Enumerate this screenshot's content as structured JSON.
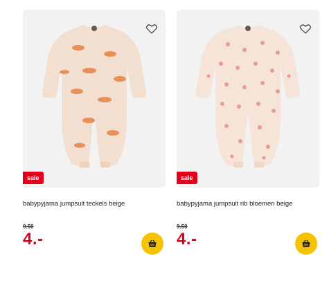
{
  "colors": {
    "sale_red": "#e0001b",
    "basket_yellow": "#f7c300",
    "card_bg": "#f2f2f3"
  },
  "products": [
    {
      "title": "babypyjama jumpsuit teckels beige",
      "badge": "sale",
      "old_price": "9.50",
      "price": "4.-",
      "favorite_icon": "heart-icon",
      "basket_icon": "basket-icon"
    },
    {
      "title": "babypyjama jumpsuit rib bloemen beige",
      "badge": "sale",
      "old_price": "9.50",
      "price": "4.-",
      "favorite_icon": "heart-icon",
      "basket_icon": "basket-icon"
    }
  ]
}
